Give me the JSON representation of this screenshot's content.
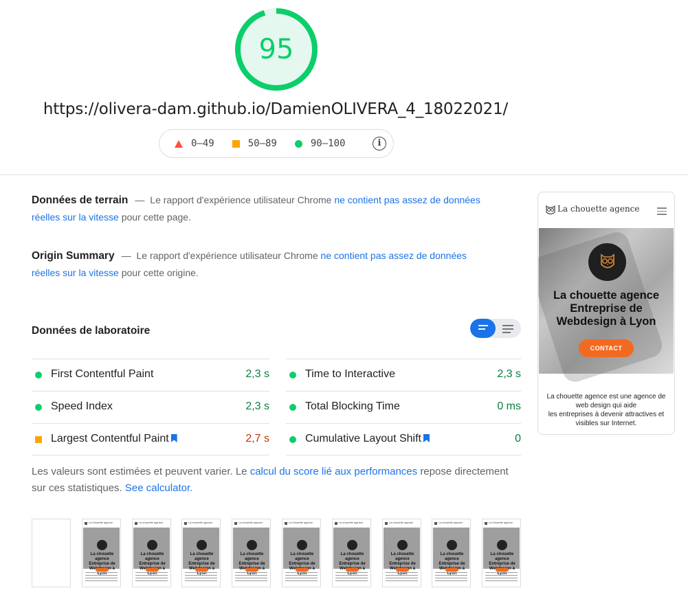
{
  "score": {
    "value": "95",
    "fraction": 0.95,
    "color": "#0cce6b",
    "url": "https://olivera-dam.github.io/DamienOLIVERA_4_18022021/"
  },
  "legend": {
    "items": [
      {
        "label": "0–49",
        "shape": "triangle",
        "color": "#ff4e42"
      },
      {
        "label": "50–89",
        "shape": "square",
        "color": "#ffa400"
      },
      {
        "label": "90–100",
        "shape": "circle",
        "color": "#0cce6b"
      }
    ],
    "info_icon": "info-icon"
  },
  "field_data": {
    "title": "Données de terrain",
    "dash": "—",
    "text_before": "Le rapport d'expérience utilisateur Chrome",
    "link": "ne contient pas assez de données réelles sur la vitesse",
    "text_after": "pour cette page."
  },
  "origin_summary": {
    "title": "Origin Summary",
    "dash": "—",
    "text_before": "Le rapport d'expérience utilisateur Chrome",
    "link": "ne contient pas assez de données réelles sur la vitesse",
    "text_after": "pour cette origine."
  },
  "lab_data": {
    "title": "Données de laboratoire",
    "metrics_left": [
      {
        "name": "First Contentful Paint",
        "value": "2,3 s",
        "status": "pass"
      },
      {
        "name": "Speed Index",
        "value": "2,3 s",
        "status": "pass"
      },
      {
        "name": "Largest Contentful Paint",
        "value": "2,7 s",
        "status": "average"
      }
    ],
    "metrics_right": [
      {
        "name": "Time to Interactive",
        "value": "2,3 s",
        "status": "pass"
      },
      {
        "name": "Total Blocking Time",
        "value": "0 ms",
        "status": "pass"
      },
      {
        "name": "Cumulative Layout Shift",
        "value": "0",
        "status": "pass"
      }
    ]
  },
  "note": {
    "text_before": "Les valeurs sont estimées et peuvent varier. Le",
    "link1": "calcul du score lié aux performances",
    "text_middle": "repose directement sur ces statistiques.",
    "link2": "See calculator."
  },
  "screenshot": {
    "brand": "La chouette agence",
    "hero_title": "La chouette agence Entreprise de Webdesign à Lyon",
    "button": "CONTACT",
    "body_text": "La chouette agence est une agence de web design qui aide\nles entreprises à devenir attractives et visibles sur Internet."
  },
  "thumbnails": {
    "count": 10,
    "brand": "La chouette agence",
    "title": "La chouette agence Entreprise de Webdesign à Lyon"
  }
}
